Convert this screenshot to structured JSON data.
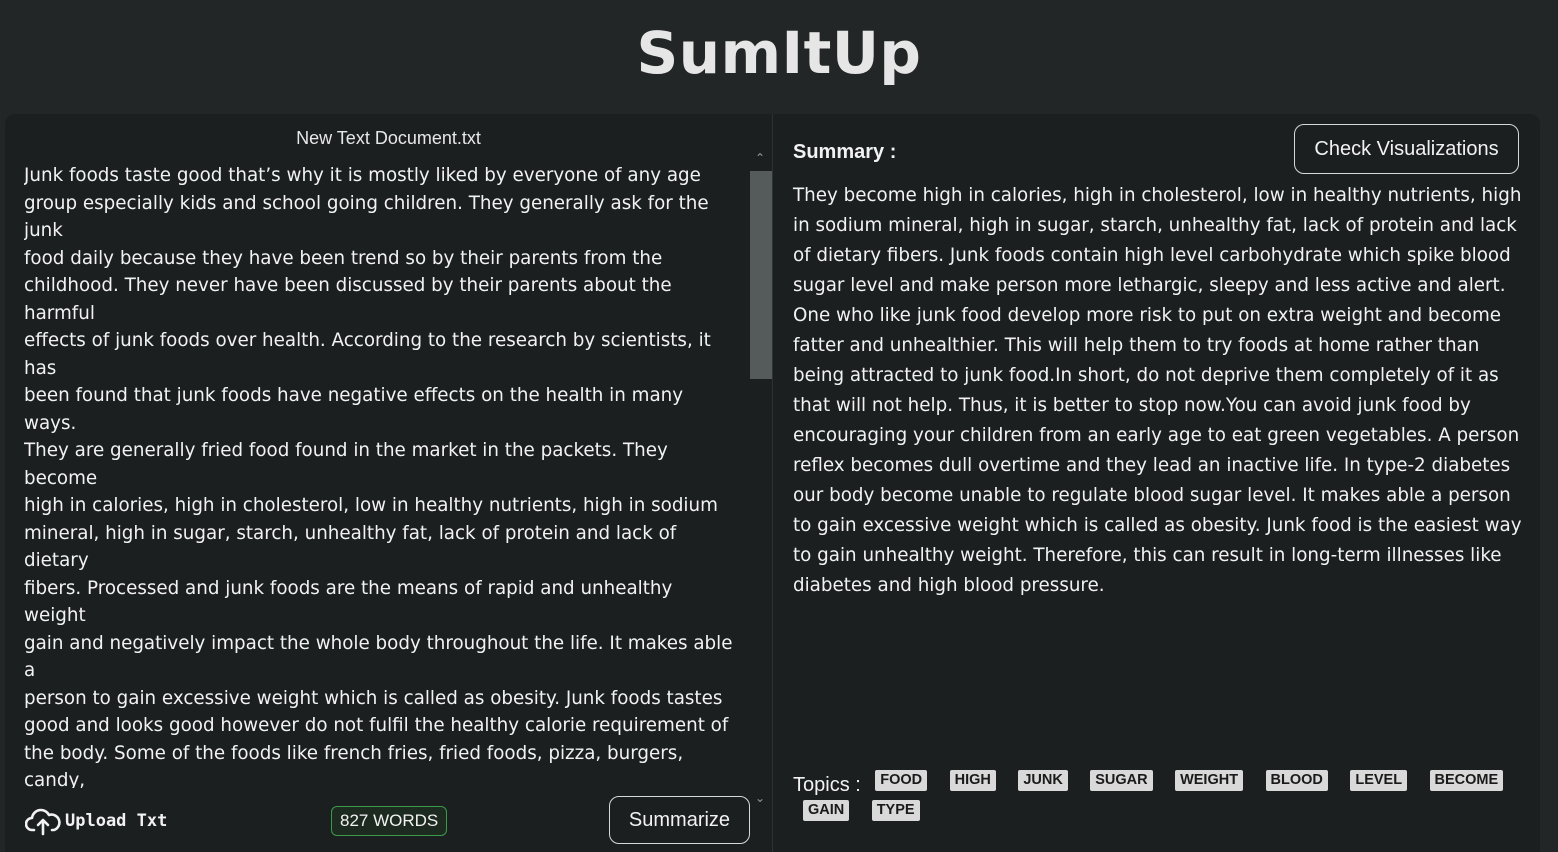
{
  "app": {
    "title": "SumItUp"
  },
  "left": {
    "file_name": "New Text Document.txt",
    "input_text": "Junk foods taste good that’s why it is mostly liked by everyone of any age\ngroup especially kids and school going children. They generally ask for the junk\nfood daily because they have been trend so by their parents from the\nchildhood. They never have been discussed by their parents about the harmful\neffects of junk foods over health. According to the research by scientists, it has\nbeen found that junk foods have negative effects on the health in many ways.\nThey are generally fried food found in the market in the packets. They become\nhigh in calories, high in cholesterol, low in healthy nutrients, high in sodium\nmineral, high in sugar, starch, unhealthy fat, lack of protein and lack of dietary\nfibers. Processed and junk foods are the means of rapid and unhealthy weight\ngain and negatively impact the whole body throughout the life. It makes able a\nperson to gain excessive weight which is called as obesity. Junk foods tastes\ngood and looks good however do not fulfil the healthy calorie requirement of\nthe body. Some of the foods like french fries, fried foods, pizza, burgers, candy,\nsoft drinks, baked goods, ice cream, cookies, etc are the example of high-sugar\nand high-fat containing foods. It is found according to the Centres for Disease\nControl and Prevention that Kids and children eating junk food are more prone\nto the type-2 diabetes. In type-2 diabetes our body become unable to regulate\nblood sugar level. Risk of getting this disease is increasing as one become more\nobese or overweight. It increases the risk of kidney failure. Eating junk food\ndaily lead us to the nutritional deficiencies in the body because it is lack of\nessential nutrients, vitamins, iron, minerals and dietary fibers. It increases risk of\ncardiovascular diseases because it is rich in saturated fat, sodium and bad",
    "upload_label": "Upload Txt",
    "word_count": "827 WORDS",
    "summarize_label": "Summarize",
    "word_count_color": "#3a9a4a"
  },
  "right": {
    "summary_heading": "Summary :",
    "visualize_label": "Check Visualizations",
    "summary_text": "They become high in calories, high in cholesterol, low in healthy nutrients, high in sodium mineral, high in sugar, starch, unhealthy fat, lack of protein and lack of dietary fibers. Junk foods contain high level carbohydrate which spike blood sugar level and make person more lethargic, sleepy and less active and alert. One who like junk food develop more risk to put on extra weight and become fatter and unhealthier. This will help them to try foods at home rather than being attracted to junk food.In short, do not deprive them completely of it as that will not help. Thus, it is better to stop now.You can avoid junk food by encouraging your children from an early age to eat green vegetables. A person reflex becomes dull overtime and they lead an inactive life. In type-2 diabetes our body become unable to regulate blood sugar level. It makes able a person to gain excessive weight which is called as obesity. Junk food is the easiest way to gain unhealthy weight. Therefore, this can result in long-term illnesses like diabetes and high blood pressure.",
    "topics_label": "Topics :",
    "topics": [
      "FOOD",
      "HIGH",
      "JUNK",
      "SUGAR",
      "WEIGHT",
      "BLOOD",
      "LEVEL",
      "BECOME",
      "GAIN",
      "TYPE"
    ]
  },
  "icons": {
    "upload": "cloud-upload-icon",
    "scroll_up": "chevron-up-icon",
    "scroll_down": "chevron-down-icon"
  },
  "colors": {
    "background": "#222627",
    "panel": "#1b1f20",
    "chip": "#d9d9d9"
  }
}
